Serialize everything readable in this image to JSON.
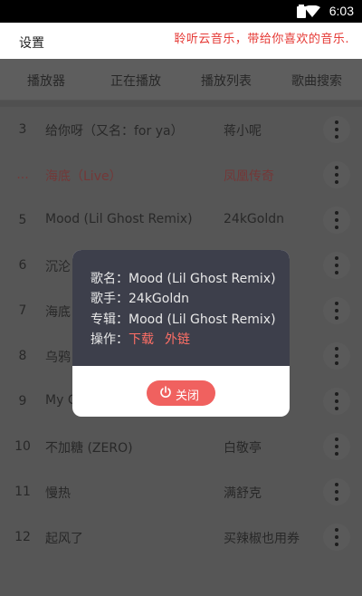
{
  "status_bar": {
    "time": "6:03"
  },
  "header": {
    "settings_label": "设置",
    "slogan": "聆听云音乐，带给你喜欢的音乐."
  },
  "tabs": [
    {
      "label": "播放器"
    },
    {
      "label": "正在播放"
    },
    {
      "label": "播放列表"
    },
    {
      "label": "歌曲搜索"
    }
  ],
  "songs": [
    {
      "num": "3",
      "title": "给你呀（又名：for ya）",
      "artist": "蒋小呢"
    },
    {
      "num": "...",
      "title": "海底（Live）",
      "artist": "凤凰传奇",
      "current": true
    },
    {
      "num": "5",
      "title": "Mood (Lil Ghost Remix)",
      "artist": "24kGoldn"
    },
    {
      "num": "6",
      "title": "沉沦",
      "artist": ""
    },
    {
      "num": "7",
      "title": "海底",
      "artist": ""
    },
    {
      "num": "8",
      "title": "乌鸦",
      "artist": ""
    },
    {
      "num": "9",
      "title": "My C",
      "artist": ""
    },
    {
      "num": "10",
      "title": "不加糖 (ZERO)",
      "artist": "白敬亭"
    },
    {
      "num": "11",
      "title": "慢热",
      "artist": "满舒克"
    },
    {
      "num": "12",
      "title": "起风了",
      "artist": "买辣椒也用券"
    }
  ],
  "dialog": {
    "song_label": "歌名：",
    "song_value": "Mood (Lil Ghost Remix)",
    "artist_label": "歌手：",
    "artist_value": "24kGoldn",
    "album_label": "专辑：",
    "album_value": "Mood (Lil Ghost Remix)",
    "action_label": "操作：",
    "download_label": "下载",
    "external_label": "外链",
    "close_label": "关闭"
  }
}
